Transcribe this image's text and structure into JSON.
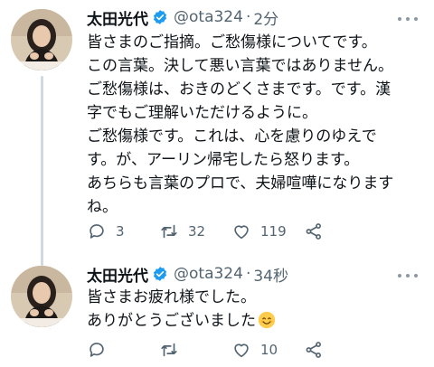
{
  "tweets": [
    {
      "author": {
        "name": "太田光代",
        "handle": "@ota324",
        "separator": "·",
        "time": "2分"
      },
      "lines": [
        "皆さまのご指摘。ご愁傷様についてです。",
        "この言葉。決して悪い言葉ではありません。",
        "ご愁傷様は、おきのどくさまです。です。漢",
        "字でもご理解いただけるように。",
        "ご愁傷様です。これは、心を慮りのゆえで",
        "す。が、アーリン帰宅したら怒ります。",
        "あちらも言葉のプロで、夫婦喧嘩になります",
        "ね。"
      ],
      "stats": {
        "replies": "3",
        "retweets": "32",
        "likes": "119"
      }
    },
    {
      "author": {
        "name": "太田光代",
        "handle": "@ota324",
        "separator": "·",
        "time": "34秒"
      },
      "lines": [
        "皆さまお疲れ様でした。",
        "ありがとうございました"
      ],
      "stats": {
        "replies": "",
        "retweets": "",
        "likes": "10"
      }
    }
  ],
  "colors": {
    "text": "#0f1419",
    "muted": "#536471",
    "verified": "#1d9bf0",
    "thread_line": "#cfd9de"
  },
  "icons": [
    "verified-badge-icon",
    "more-icon",
    "reply-icon",
    "retweet-icon",
    "like-icon",
    "share-icon",
    "smiling-face-emoji"
  ]
}
